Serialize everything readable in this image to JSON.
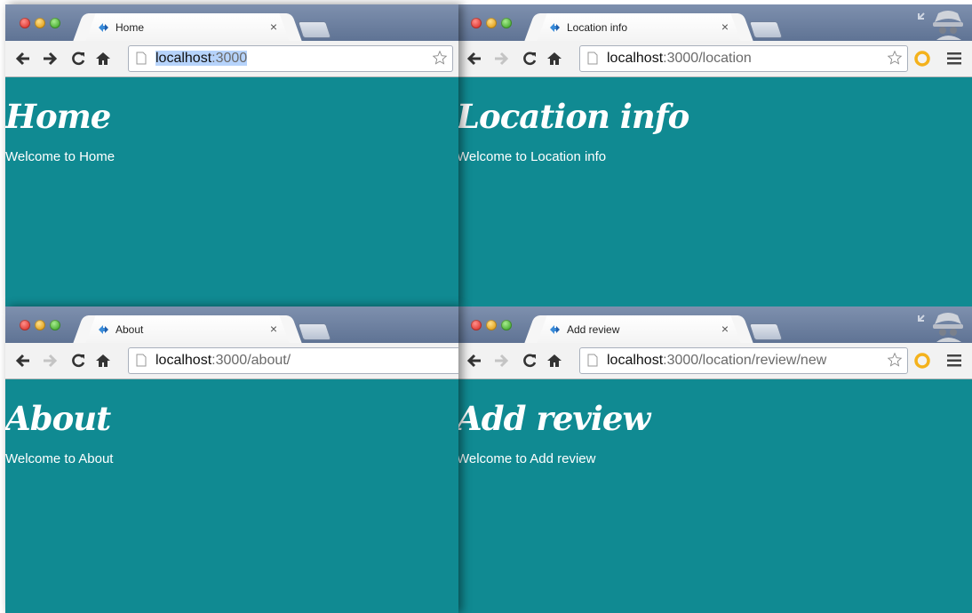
{
  "windows": [
    {
      "tab_title": "Home",
      "url_host": "localhost",
      "url_rest": ":3000",
      "heading": "Home",
      "text": "Welcome to Home",
      "url_selected": true
    },
    {
      "tab_title": "Location info",
      "url_host": "localhost",
      "url_rest": ":3000/location",
      "heading": "Location info",
      "text": "Welcome to Location info",
      "incognito": true,
      "extension": "sun-icon"
    },
    {
      "tab_title": "About",
      "url_host": "localhost",
      "url_rest": ":3000/about/",
      "heading": "About",
      "text": "Welcome to About"
    },
    {
      "tab_title": "Add review",
      "url_host": "localhost",
      "url_rest": ":3000/location/review/new",
      "heading": "Add review",
      "text": "Welcome to Add review",
      "incognito": true,
      "extension": "sun-icon"
    }
  ],
  "close_glyph": "×",
  "colors": {
    "page_background": "#108a92",
    "title_bar": "#6f82a3",
    "toolbar": "#f2f2f2",
    "url_highlight": "#b6d3fb"
  }
}
